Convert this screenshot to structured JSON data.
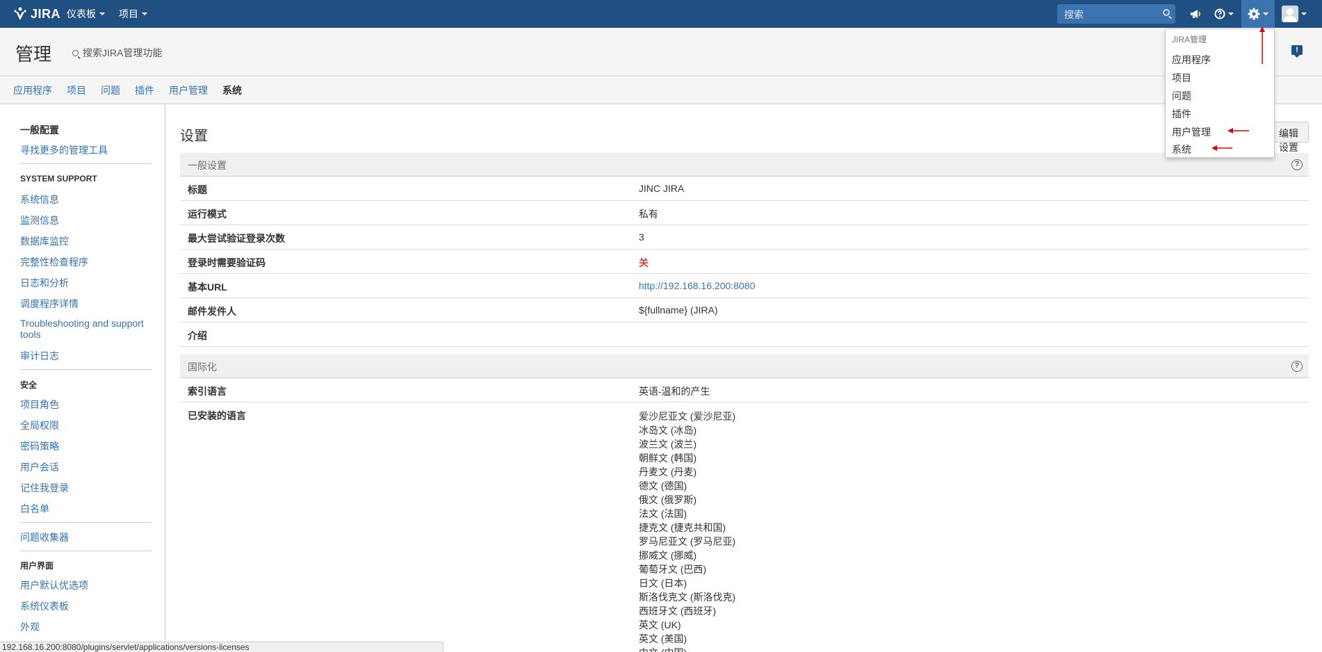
{
  "topbar": {
    "logo_text": "JIRA",
    "nav": [
      {
        "label": "仪表板"
      },
      {
        "label": "项目"
      }
    ],
    "search_placeholder": "搜索"
  },
  "admin": {
    "title": "管理",
    "search_label": "搜索JIRA管理功能",
    "tabs": [
      {
        "label": "应用程序"
      },
      {
        "label": "项目"
      },
      {
        "label": "问题"
      },
      {
        "label": "插件"
      },
      {
        "label": "用户管理"
      },
      {
        "label": "系统"
      }
    ]
  },
  "sidebar": {
    "general_config": "一般配置",
    "find_more_tools": "寻找更多的管理工具",
    "system_support_head": "SYSTEM SUPPORT",
    "system_support_items": [
      "系统信息",
      "监测信息",
      "数据库监控",
      "完整性检查程序",
      "日志和分析",
      "调度程序详情",
      "Troubleshooting and support tools",
      "审计日志"
    ],
    "security_head": "安全",
    "security_items": [
      "项目角色",
      "全局权限",
      "密码策略",
      "用户会话",
      "记住我登录",
      "白名单"
    ],
    "issue_collectors": "问题收集器",
    "ui_head": "用户界面",
    "ui_items": [
      "用户默认优选项",
      "系统仪表板",
      "外观"
    ]
  },
  "main": {
    "heading": "设置",
    "edit_button_label": "编辑设置",
    "general_section": "一般设置",
    "general_rows": [
      {
        "label": "标题",
        "value": "JINC JIRA"
      },
      {
        "label": "运行模式",
        "value": "私有"
      },
      {
        "label": "最大尝试验证登录次数",
        "value": "3"
      },
      {
        "label": "登录时需要验证码",
        "value": "关"
      },
      {
        "label": "基本URL",
        "value": "http://192.168.16.200:8080"
      },
      {
        "label": "邮件发件人",
        "value": "${fullname} (JIRA)"
      },
      {
        "label": "介绍",
        "value": ""
      }
    ],
    "i18n_section": "国际化",
    "index_language_label": "索引语言",
    "index_language_value": "英语-温和的产生",
    "installed_languages_label": "已安装的语言",
    "installed_languages": [
      "爱沙尼亚文 (爱沙尼亚)",
      "冰岛文 (冰岛)",
      "波兰文 (波兰)",
      "朝鲜文 (韩国)",
      "丹麦文 (丹麦)",
      "德文 (德国)",
      "俄文 (俄罗斯)",
      "法文 (法国)",
      "捷克文 (捷克共和国)",
      "罗马尼亚文 (罗马尼亚)",
      "挪威文 (挪威)",
      "葡萄牙文 (巴西)",
      "日文 (日本)",
      "斯洛伐克文 (斯洛伐克)",
      "西班牙文 (西班牙)",
      "英文 (UK)",
      "英文 (美国)",
      "中文 (中国)"
    ]
  },
  "dropdown": {
    "heading": "JIRA管理",
    "items": [
      "应用程序",
      "项目",
      "问题",
      "插件",
      "用户管理",
      "系统"
    ]
  },
  "statusbar": {
    "url": "192.168.16.200:8080/plugins/servlet/applications/versions-licenses"
  },
  "colors": {
    "header_bg": "#205081",
    "link": "#3572b0",
    "annotation_red": "#e00000",
    "off_value": "#d04437"
  }
}
